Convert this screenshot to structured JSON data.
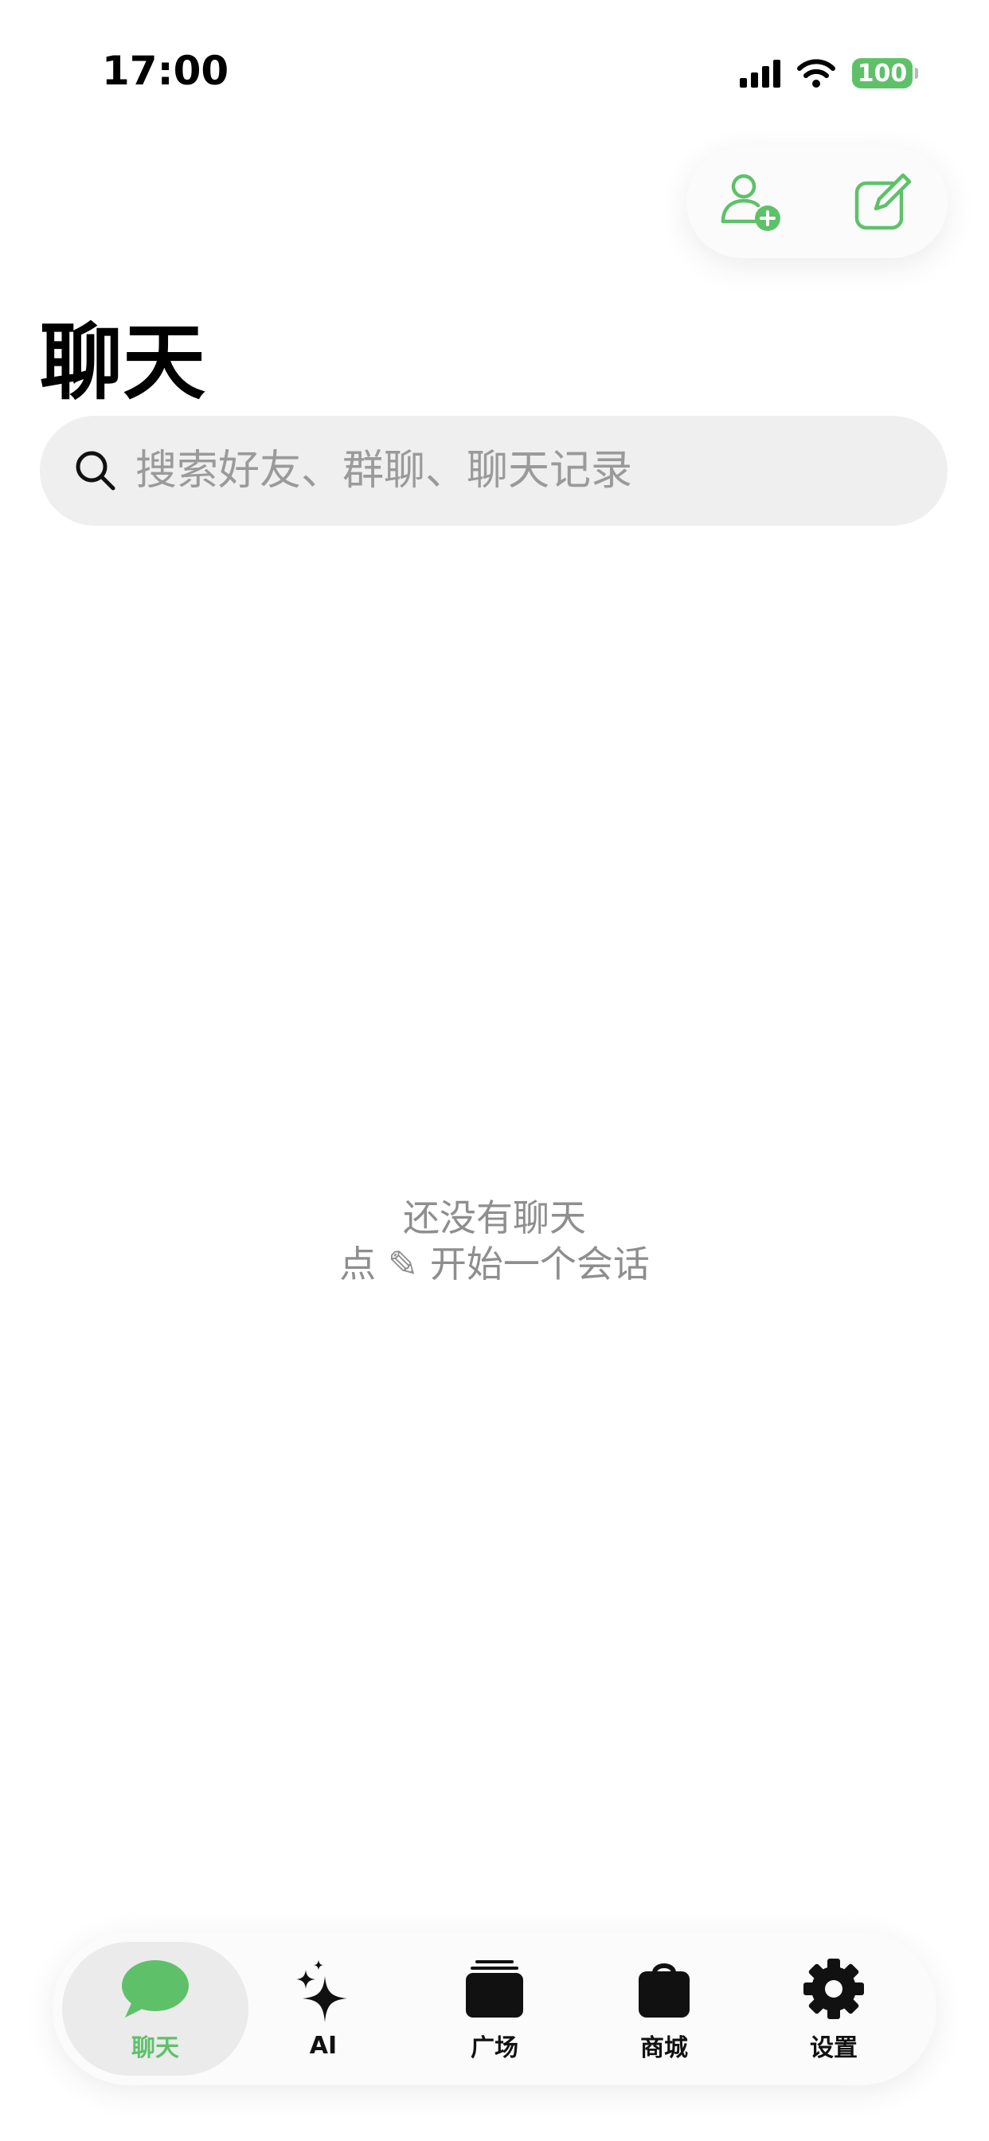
{
  "status_bar": {
    "time": "17:00",
    "battery": "100"
  },
  "colors": {
    "accent": "#5ec16a",
    "text_secondary": "#8e8e8e",
    "search_bg": "#efefef"
  },
  "header": {
    "title": "聊天",
    "actions": [
      {
        "icon": "add-friend-icon"
      },
      {
        "icon": "compose-icon"
      }
    ]
  },
  "search": {
    "placeholder": "搜索好友、群聊、聊天记录",
    "value": ""
  },
  "empty_state": {
    "line1": "还没有聊天",
    "line2": "点 ✎ 开始一个会话"
  },
  "tab_bar": {
    "active_index": 0,
    "items": [
      {
        "label": "聊天",
        "icon": "chat-bubble-icon"
      },
      {
        "label": "AI",
        "icon": "sparkles-icon"
      },
      {
        "label": "广场",
        "icon": "stack-icon"
      },
      {
        "label": "商城",
        "icon": "shopping-bag-icon"
      },
      {
        "label": "设置",
        "icon": "gear-icon"
      }
    ]
  }
}
